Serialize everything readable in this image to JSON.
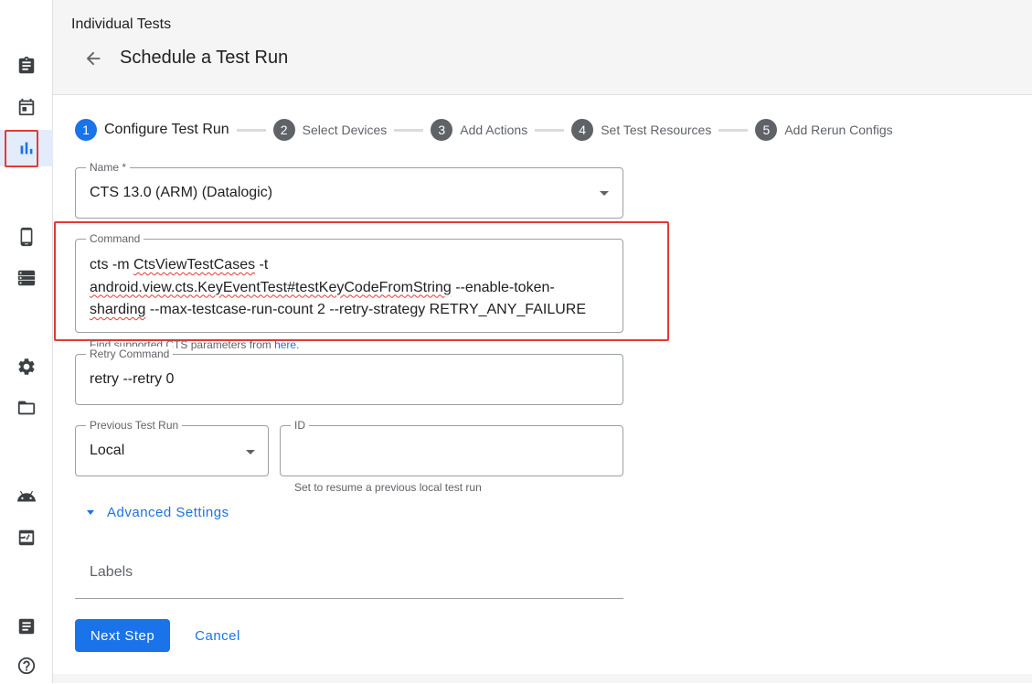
{
  "header": {
    "breadcrumb": "Individual Tests",
    "title": "Schedule a Test Run"
  },
  "nav": [
    {
      "icon": "clipboard-icon"
    },
    {
      "icon": "calendar-icon"
    },
    {
      "icon": "bar-chart-icon",
      "active": true
    },
    {
      "icon": "phone-icon"
    },
    {
      "icon": "server-icon"
    },
    {
      "icon": "gear-icon"
    },
    {
      "icon": "folder-icon"
    },
    {
      "icon": "android-icon"
    },
    {
      "icon": "monitor-heartbeat-icon"
    },
    {
      "icon": "document-icon"
    },
    {
      "icon": "help-icon"
    }
  ],
  "stepper": [
    {
      "num": "1",
      "label": "Configure Test Run",
      "active": true
    },
    {
      "num": "2",
      "label": "Select Devices"
    },
    {
      "num": "3",
      "label": "Add Actions"
    },
    {
      "num": "4",
      "label": "Set Test Resources"
    },
    {
      "num": "5",
      "label": "Add Rerun Configs"
    }
  ],
  "form": {
    "name": {
      "label": "Name *",
      "value": "CTS 13.0 (ARM) (Datalogic)"
    },
    "command": {
      "label": "Command",
      "line1_a": "cts -m ",
      "line1_b": "CtsViewTestCases",
      "line1_c": " -t",
      "line2_a": "android.view.cts.KeyEventTest#testKeyCodeFromString",
      "line2_b": " --enable-token-",
      "line3_a": "sharding",
      "line3_b": " --max-testcase-run-count 2 --retry-strategy RETRY_ANY_FAILURE"
    },
    "hint_prefix": "Find supported CTS parameters from ",
    "hint_link": "here",
    "hint_suffix": ".",
    "retry": {
      "label": "Retry Command",
      "value": "retry --retry 0"
    },
    "previous": {
      "label": "Previous Test Run",
      "value": "Local"
    },
    "id": {
      "label": "ID",
      "value": "",
      "hint": "Set to resume a previous local test run"
    },
    "advanced_label": "Advanced Settings",
    "labels_placeholder": "Labels"
  },
  "actions": {
    "next": "Next Step",
    "cancel": "Cancel"
  },
  "colors": {
    "accent": "#1a73e8",
    "highlight": "#e53935",
    "active_nav_bg": "#e3ecfb"
  }
}
